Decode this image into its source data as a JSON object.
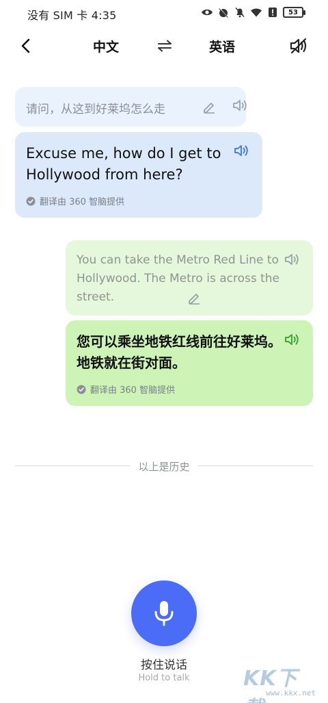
{
  "status_bar": {
    "carrier_time": "没有 SIM 卡 4:35",
    "battery": "53"
  },
  "header": {
    "source_language": "中文",
    "target_language": "英语"
  },
  "conversation": [
    {
      "side": "left",
      "source_text": "请问，从这到好莱坞怎么走",
      "translated_text": "Excuse me, how do I get to Hollywood from here?",
      "credit": "翻译由 360 智脑提供"
    },
    {
      "side": "right",
      "source_text": "You can take the Metro Red Line to Hollywood. The Metro is across the street.",
      "translated_text": "您可以乘坐地铁红线前往好莱坞。地铁就在街对面。",
      "credit": "翻译由 360 智脑提供"
    }
  ],
  "history_divider": "以上是历史",
  "mic": {
    "label_cn": "按住说话",
    "label_en": "Hold to talk"
  },
  "watermark": {
    "logo": "KK下载",
    "url": "www.kkx.net"
  },
  "colors": {
    "accent": "#4a6cf6",
    "left_source_bg": "#eaf2fd",
    "left_translation_bg": "#dbe9fb",
    "right_source_bg": "#e6f8db",
    "right_translation_bg": "#cdf3b7",
    "left_speaker": "#4a7fd6",
    "right_speaker": "#3aa53a"
  }
}
